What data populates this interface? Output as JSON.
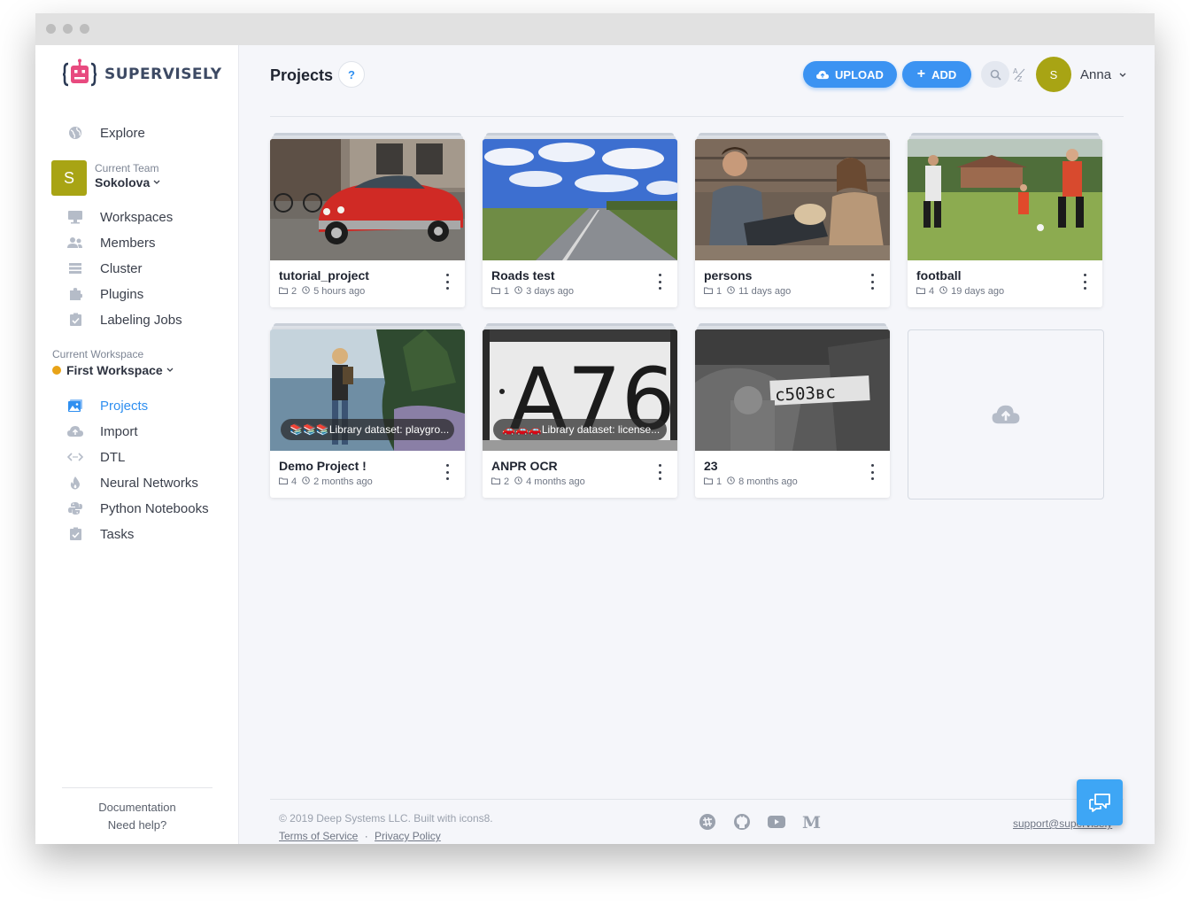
{
  "brand": {
    "name": "SUPERVISELY",
    "accent": "#2f8ff0",
    "team_color": "#a8a414"
  },
  "sidebar": {
    "explore": "Explore",
    "team": {
      "label": "Current Team",
      "name": "Sokolova",
      "initial": "S"
    },
    "team_items": [
      {
        "label": "Workspaces",
        "icon": "monitor-icon"
      },
      {
        "label": "Members",
        "icon": "members-icon"
      },
      {
        "label": "Cluster",
        "icon": "cluster-icon"
      },
      {
        "label": "Plugins",
        "icon": "puzzle-icon"
      },
      {
        "label": "Labeling Jobs",
        "icon": "checkbox-icon"
      }
    ],
    "workspace": {
      "label": "Current Workspace",
      "name": "First Workspace"
    },
    "workspace_items": [
      {
        "label": "Projects",
        "icon": "images-icon",
        "active": true
      },
      {
        "label": "Import",
        "icon": "cloud-upload-icon"
      },
      {
        "label": "DTL",
        "icon": "code-icon"
      },
      {
        "label": "Neural Networks",
        "icon": "flame-icon"
      },
      {
        "label": "Python Notebooks",
        "icon": "python-icon"
      },
      {
        "label": "Tasks",
        "icon": "checkbox-icon"
      }
    ],
    "footer": {
      "documentation": "Documentation",
      "help": "Need help?"
    }
  },
  "header": {
    "title": "Projects",
    "help": "?",
    "upload_label": "UPLOAD",
    "add_label": "ADD",
    "user": {
      "name": "Anna",
      "initial": "S"
    }
  },
  "projects": [
    {
      "name": "tutorial_project",
      "datasets": "2",
      "updated": "5 hours ago",
      "badge": ""
    },
    {
      "name": "Roads test",
      "datasets": "1",
      "updated": "3 days ago",
      "badge": ""
    },
    {
      "name": "persons",
      "datasets": "1",
      "updated": "11 days ago",
      "badge": ""
    },
    {
      "name": "football",
      "datasets": "4",
      "updated": "19 days ago",
      "badge": ""
    },
    {
      "name": "Demo Project !",
      "datasets": "4",
      "updated": "2 months ago",
      "badge": "📚📚📚Library dataset: playgro..."
    },
    {
      "name": "ANPR OCR",
      "datasets": "2",
      "updated": "4 months ago",
      "badge": "🚗🚗🚗Library dataset: license..."
    },
    {
      "name": "23",
      "datasets": "1",
      "updated": "8 months ago",
      "badge": ""
    }
  ],
  "footer": {
    "copyright": "© 2019 Deep Systems LLC. Built with icons8.",
    "terms": "Terms of Service",
    "separator": "·",
    "privacy": "Privacy Policy",
    "support": "support@supervisely"
  }
}
